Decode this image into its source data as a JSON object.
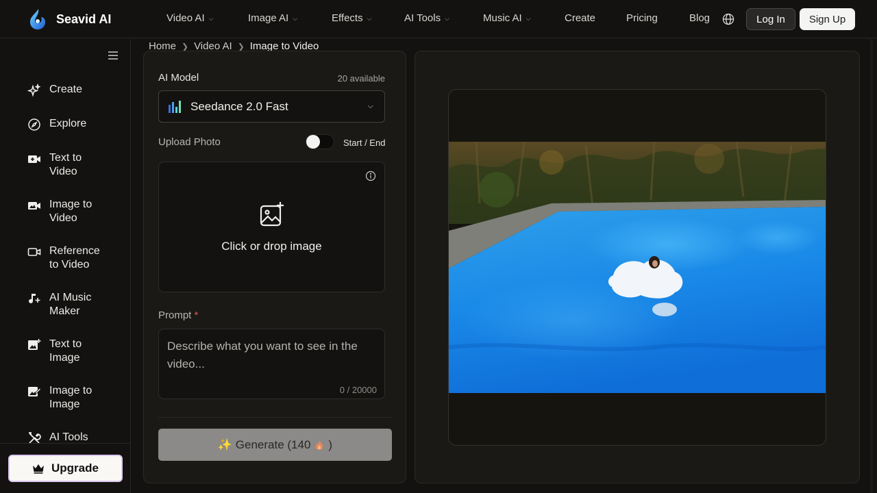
{
  "brand": {
    "name": "Seavid AI"
  },
  "nav": {
    "items": [
      {
        "label": "Video AI",
        "dropdown": true
      },
      {
        "label": "Image AI",
        "dropdown": true
      },
      {
        "label": "Effects",
        "dropdown": true
      },
      {
        "label": "AI Tools",
        "dropdown": true
      },
      {
        "label": "Music AI",
        "dropdown": true
      },
      {
        "label": "Create",
        "dropdown": false
      },
      {
        "label": "Pricing",
        "dropdown": false
      },
      {
        "label": "Blog",
        "dropdown": false
      }
    ],
    "login_label": "Log In",
    "signup_label": "Sign Up"
  },
  "sidebar": {
    "items": [
      {
        "label": "Create",
        "icon": "sparkle-icon"
      },
      {
        "label": "Explore",
        "icon": "compass-icon"
      },
      {
        "label": "Text to Video",
        "icon": "video-plus-icon"
      },
      {
        "label": "Image to Video",
        "icon": "image-video-icon"
      },
      {
        "label": "Reference to Video",
        "icon": "camera-icon"
      },
      {
        "label": "AI Music Maker",
        "icon": "music-plus-icon"
      },
      {
        "label": "Text to Image",
        "icon": "image-plus-icon"
      },
      {
        "label": "Image to Image",
        "icon": "image-edit-icon"
      },
      {
        "label": "AI Tools",
        "icon": "tools-icon"
      }
    ],
    "upgrade_label": "Upgrade"
  },
  "breadcrumb": [
    "Home",
    "Video AI",
    "Image to Video"
  ],
  "form": {
    "model_label": "AI Model",
    "model_count": "20 available",
    "model_selected": "Seedance 2.0 Fast",
    "upload_label": "Upload Photo",
    "toggle_label": "Start / End",
    "toggle_on": false,
    "drop_text": "Click or drop image",
    "prompt_label": "Prompt",
    "prompt_required": "*",
    "prompt_placeholder": "Describe what you want to see in the video...",
    "prompt_counter": "0 / 20000",
    "generate_label": "✨ Generate (140",
    "generate_suffix": ")"
  },
  "colors": {
    "background": "#141210",
    "panel": "#1b1916",
    "accent_required": "#e05656",
    "generate_disabled": "#8b8a88"
  }
}
